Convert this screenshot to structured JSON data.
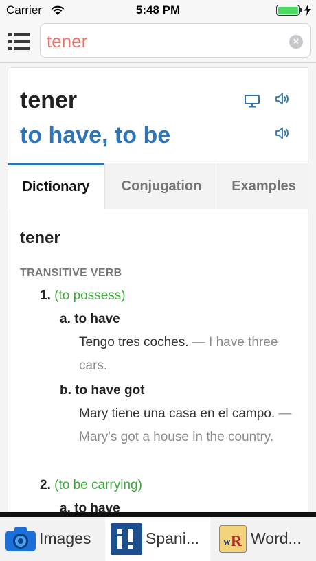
{
  "status_bar": {
    "carrier": "Carrier",
    "time": "5:48 PM"
  },
  "search": {
    "value": "tener"
  },
  "header": {
    "word": "tener",
    "translation": "to have, to be"
  },
  "tabs": [
    {
      "label": "Dictionary",
      "selected": true
    },
    {
      "label": "Conjugation",
      "selected": false
    },
    {
      "label": "Examples",
      "selected": false
    }
  ],
  "entry": {
    "word": "tener",
    "part_of_speech": "TRANSITIVE VERB",
    "senses": [
      {
        "number": "1.",
        "gloss": "(to possess)",
        "subsenses": [
          {
            "letter": "a. to have",
            "example_es": "Tengo tres coches.",
            "example_en": " — I have three cars."
          },
          {
            "letter": "b. to have got",
            "example_es": "Mary tiene una casa en el campo.",
            "example_en": " — Mary's got a house in the country."
          }
        ]
      },
      {
        "number": "2.",
        "gloss": "(to be carrying)",
        "subsenses": [
          {
            "letter": "a. to have"
          }
        ]
      }
    ]
  },
  "app_switcher": [
    {
      "label": "Images",
      "icon": "camera-icon"
    },
    {
      "label": "Spani...",
      "icon": "spanishdict-icon"
    },
    {
      "label": "Word...",
      "icon": "wordreference-icon"
    }
  ],
  "colors": {
    "accent_blue": "#2d75b8",
    "gloss_green": "#3fa83b",
    "search_text": "#e8766f"
  }
}
